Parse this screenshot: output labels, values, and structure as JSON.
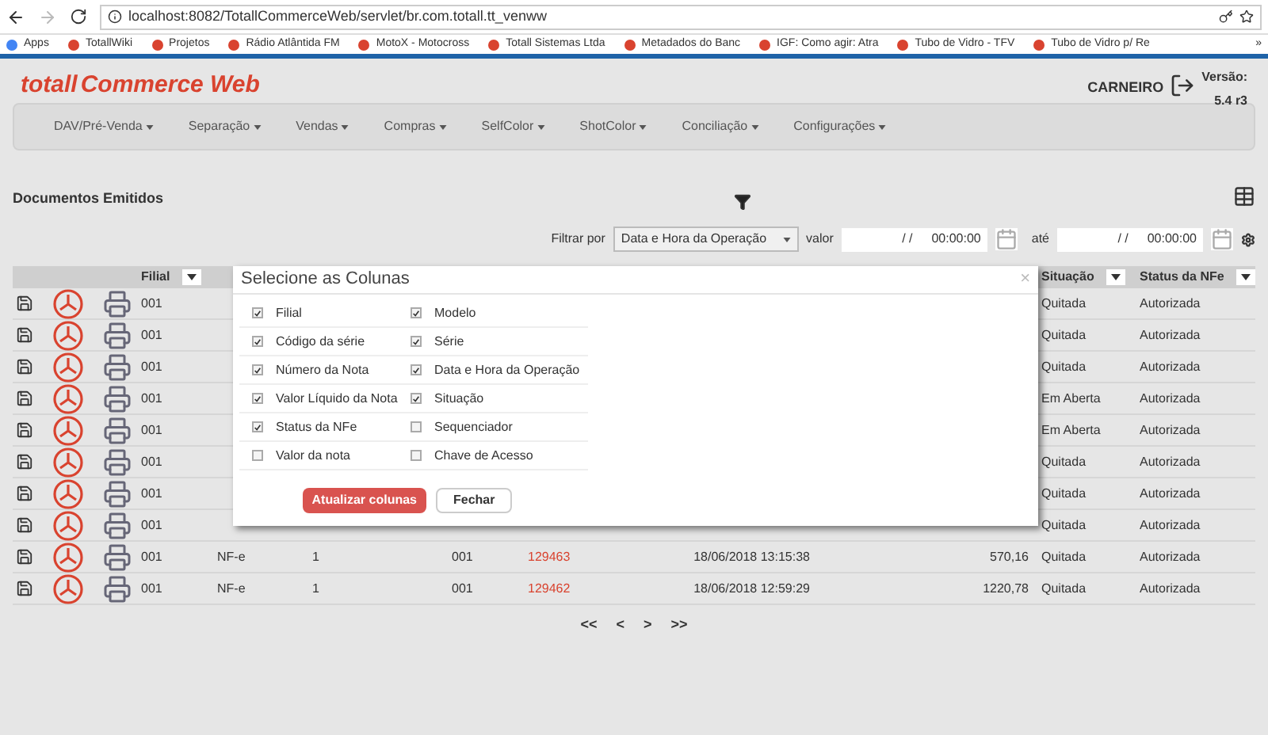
{
  "browser": {
    "url": "localhost:8082/TotallCommerceWeb/servlet/br.com.totall.tt_venww",
    "bookmarks": [
      "Apps",
      "TotallWiki",
      "Projetos",
      "Rádio Atlântida FM",
      "MotoX - Motocross",
      "Totall Sistemas Ltda",
      "Metadados do Banc",
      "IGF: Como agir: Atra",
      "Tubo de Vidro - TFV",
      "Tubo de Vidro p/ Re"
    ],
    "more": "»"
  },
  "header": {
    "logo_left": "totall",
    "logo_right": "Commerce Web",
    "user": "CARNEIRO",
    "version_label": "Versão:",
    "version": "5.4 r3"
  },
  "menu": [
    "DAV/Pré-Venda",
    "Separação",
    "Vendas",
    "Compras",
    "SelfColor",
    "ShotColor",
    "Conciliação",
    "Configurações"
  ],
  "page_title": "Documentos Emitidos",
  "filter": {
    "label": "Filtrar por",
    "field": "Data e Hora da Operação",
    "value_label": "valor",
    "from_date": "/  /",
    "from_time": "00:00:00",
    "to_label": "até",
    "to_date": "/  /",
    "to_time": "00:00:00"
  },
  "table": {
    "columns": [
      "Filial",
      "",
      "",
      "",
      "",
      "",
      "",
      "Situação",
      "Status da NFe"
    ],
    "rows": [
      {
        "filial": "001",
        "situacao": "Quitada",
        "status": "Autorizada"
      },
      {
        "filial": "001",
        "situacao": "Quitada",
        "status": "Autorizada"
      },
      {
        "filial": "001",
        "situacao": "Quitada",
        "status": "Autorizada"
      },
      {
        "filial": "001",
        "situacao": "Em Aberta",
        "status": "Autorizada"
      },
      {
        "filial": "001",
        "situacao": "Em Aberta",
        "status": "Autorizada"
      },
      {
        "filial": "001",
        "situacao": "Quitada",
        "status": "Autorizada"
      },
      {
        "filial": "001",
        "situacao": "Quitada",
        "status": "Autorizada"
      },
      {
        "filial": "001",
        "situacao": "Quitada",
        "status": "Autorizada"
      },
      {
        "filial": "001",
        "modelo": "NF-e",
        "codigo": "1",
        "serie": "001",
        "numero": "129463",
        "data": "18/06/2018 13:15:38",
        "valor": "570,16",
        "situacao": "Quitada",
        "status": "Autorizada"
      },
      {
        "filial": "001",
        "modelo": "NF-e",
        "codigo": "1",
        "serie": "001",
        "numero": "129462",
        "data": "18/06/2018 12:59:29",
        "valor": "1220,78",
        "situacao": "Quitada",
        "status": "Autorizada"
      }
    ]
  },
  "pagination": [
    "<<",
    "<",
    ">",
    ">>"
  ],
  "modal": {
    "title": "Selecione as Colunas",
    "close": "×",
    "options": [
      {
        "label": "Filial",
        "checked": true
      },
      {
        "label": "Modelo",
        "checked": true
      },
      {
        "label": "Código da série",
        "checked": true
      },
      {
        "label": "Série",
        "checked": true
      },
      {
        "label": "Número da Nota",
        "checked": true
      },
      {
        "label": "Data e Hora da Operação",
        "checked": true
      },
      {
        "label": "Valor Líquido da Nota",
        "checked": true
      },
      {
        "label": "Situação",
        "checked": true
      },
      {
        "label": "Status da NFe",
        "checked": true
      },
      {
        "label": "Sequenciador",
        "checked": false
      },
      {
        "label": "Valor da nota",
        "checked": false
      },
      {
        "label": "Chave de Acesso",
        "checked": false
      }
    ],
    "primary": "Atualizar colunas",
    "secondary": "Fechar"
  }
}
